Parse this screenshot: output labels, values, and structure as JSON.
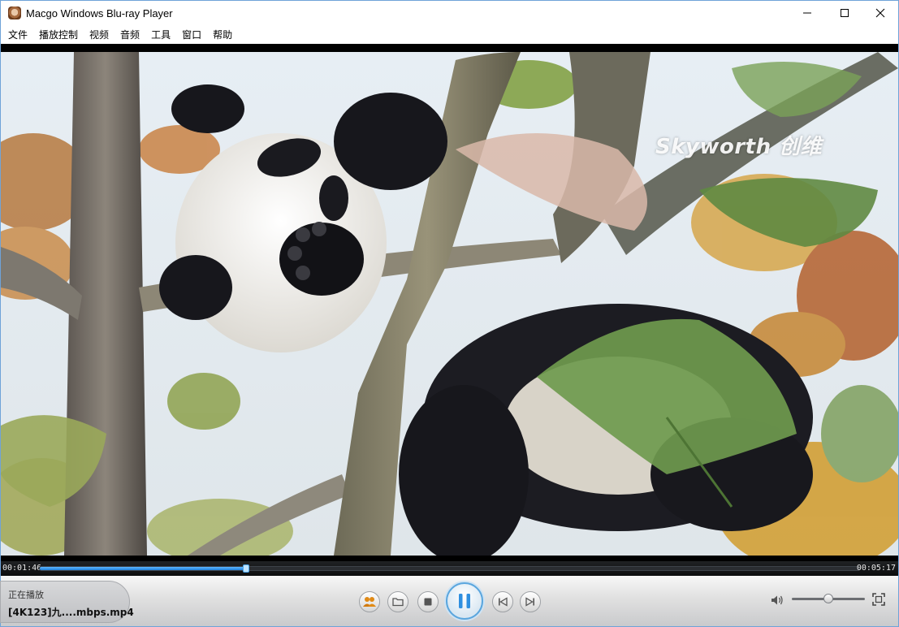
{
  "window": {
    "title": "Macgo Windows Blu-ray Player"
  },
  "menu": {
    "items": [
      {
        "label": "文件"
      },
      {
        "label": "播放控制"
      },
      {
        "label": "视频"
      },
      {
        "label": "音频"
      },
      {
        "label": "工具"
      },
      {
        "label": "窗口"
      },
      {
        "label": "帮助"
      }
    ]
  },
  "video": {
    "watermark_text": "Skyworth 创维"
  },
  "playback": {
    "current_time": "00:01:46",
    "total_time": "00:05:17",
    "progress_fraction": 0.252
  },
  "now_playing": {
    "label": "正在播放",
    "filename": "[4K123]九....mbps.mp4"
  },
  "controls": {
    "icons": [
      "community-icon",
      "open-folder-icon",
      "stop-icon",
      "pause-icon",
      "previous-icon",
      "next-icon",
      "volume-icon",
      "fullscreen-icon"
    ]
  },
  "volume": {
    "level_fraction": 0.5
  },
  "colors": {
    "accent": "#2f8fe0",
    "titlebar": "#ffffff",
    "window_border": "#6fa3d8"
  }
}
